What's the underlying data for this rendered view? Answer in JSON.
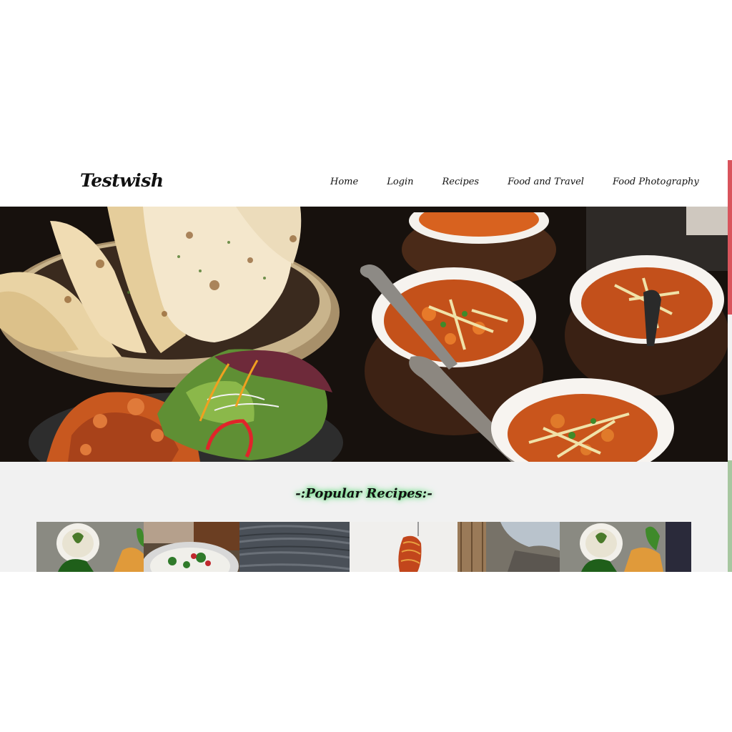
{
  "brand": {
    "name": "Testwish"
  },
  "nav": {
    "items": [
      {
        "label": "Home"
      },
      {
        "label": "Login"
      },
      {
        "label": "Recipes"
      },
      {
        "label": "Food and Travel"
      },
      {
        "label": "Food Photography"
      }
    ]
  },
  "hero": {
    "image": "indian-food-spread-photo"
  },
  "popular": {
    "title": "-:Popular Recipes:-",
    "thumbnails": [
      {
        "image": "curry-with-flatbread-photo"
      },
      {
        "image": "salad-bowl-photo"
      },
      {
        "image": "wooden-table-photo"
      },
      {
        "image": "spaghetti-on-fork-photo"
      },
      {
        "image": "wooden-crate-photo"
      },
      {
        "image": "curry-with-flatbread-photo-2"
      }
    ]
  },
  "colors": {
    "accent_scroll": "#d9545c",
    "title_glow": "#4cd26a",
    "section_bg": "#f1f1f1"
  }
}
